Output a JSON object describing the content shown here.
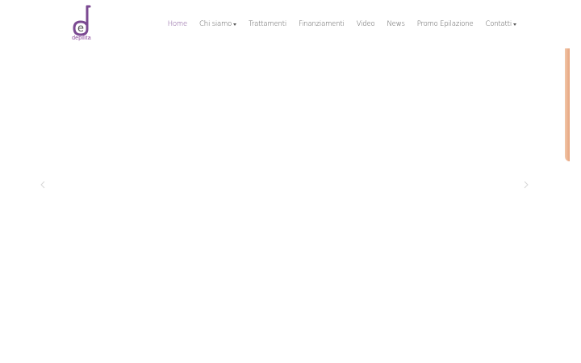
{
  "brand": {
    "logo_letter": "e",
    "logo_text": "depilita",
    "color": "#7b4a92"
  },
  "nav": {
    "items": [
      {
        "label": "Home",
        "active": true,
        "dropdown": false
      },
      {
        "label": "Chi siamo",
        "active": false,
        "dropdown": true
      },
      {
        "label": "Trattamenti",
        "active": false,
        "dropdown": false
      },
      {
        "label": "Finanziamenti",
        "active": false,
        "dropdown": false
      },
      {
        "label": "Video",
        "active": false,
        "dropdown": false
      },
      {
        "label": "News",
        "active": false,
        "dropdown": false
      },
      {
        "label": "Promo Epilazione",
        "active": false,
        "dropdown": false
      },
      {
        "label": "Contatti",
        "active": false,
        "dropdown": true
      }
    ],
    "text_color": "#555555"
  },
  "slider": {
    "prev_icon": "chevron-left-icon",
    "next_icon": "chevron-right-icon",
    "edge_color": "#e6a47f"
  }
}
